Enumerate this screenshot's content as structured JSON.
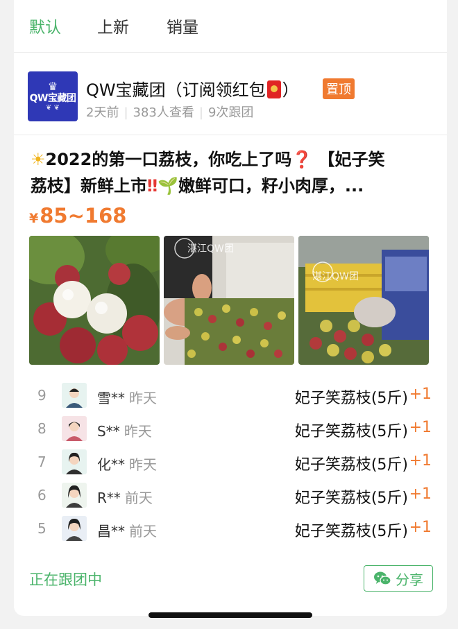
{
  "tabs": [
    {
      "label": "默认",
      "active": true
    },
    {
      "label": "上新",
      "active": false
    },
    {
      "label": "销量",
      "active": false
    }
  ],
  "group": {
    "logo_text": "QW宝藏团",
    "title_prefix": "QW宝藏团（订阅领红包",
    "title_suffix": "）",
    "badge": "置顶",
    "meta": [
      "2天前",
      "383人查看",
      "9次跟团"
    ]
  },
  "post": {
    "line1_text": "2022的第一口荔枝，你吃上了吗",
    "line1_tail": " 【妃子笑",
    "line2_head": "荔枝】新鲜上市",
    "line2_mid": "嫩鲜可口，籽小肉厚，...",
    "price_symbol": "¥",
    "price": "85~168",
    "photos": [
      {
        "name": "lychee-closeup-photo"
      },
      {
        "name": "lychee-sorting-photo",
        "watermark": "湛江QW团"
      },
      {
        "name": "lychee-crate-photo",
        "watermark": "湛江QW团"
      }
    ]
  },
  "orders": [
    {
      "num": "9",
      "name": "雪**",
      "when": "昨天",
      "item": "妃子笑荔枝(5斤)",
      "qty": "+1"
    },
    {
      "num": "8",
      "name": "S**",
      "when": "昨天",
      "item": "妃子笑荔枝(5斤)",
      "qty": "+1"
    },
    {
      "num": "7",
      "name": "化**",
      "when": "昨天",
      "item": "妃子笑荔枝(5斤)",
      "qty": "+1"
    },
    {
      "num": "6",
      "name": "R**",
      "when": "前天",
      "item": "妃子笑荔枝(5斤)",
      "qty": "+1"
    },
    {
      "num": "5",
      "name": "昌**",
      "when": "前天",
      "item": "妃子笑荔枝(5斤)",
      "qty": "+1"
    }
  ],
  "footer": {
    "status": "正在跟团中",
    "share_label": "分享"
  },
  "colors": {
    "accent_green": "#4bb46b",
    "price_orange": "#f07a30",
    "logo_blue": "#2f38b6"
  }
}
